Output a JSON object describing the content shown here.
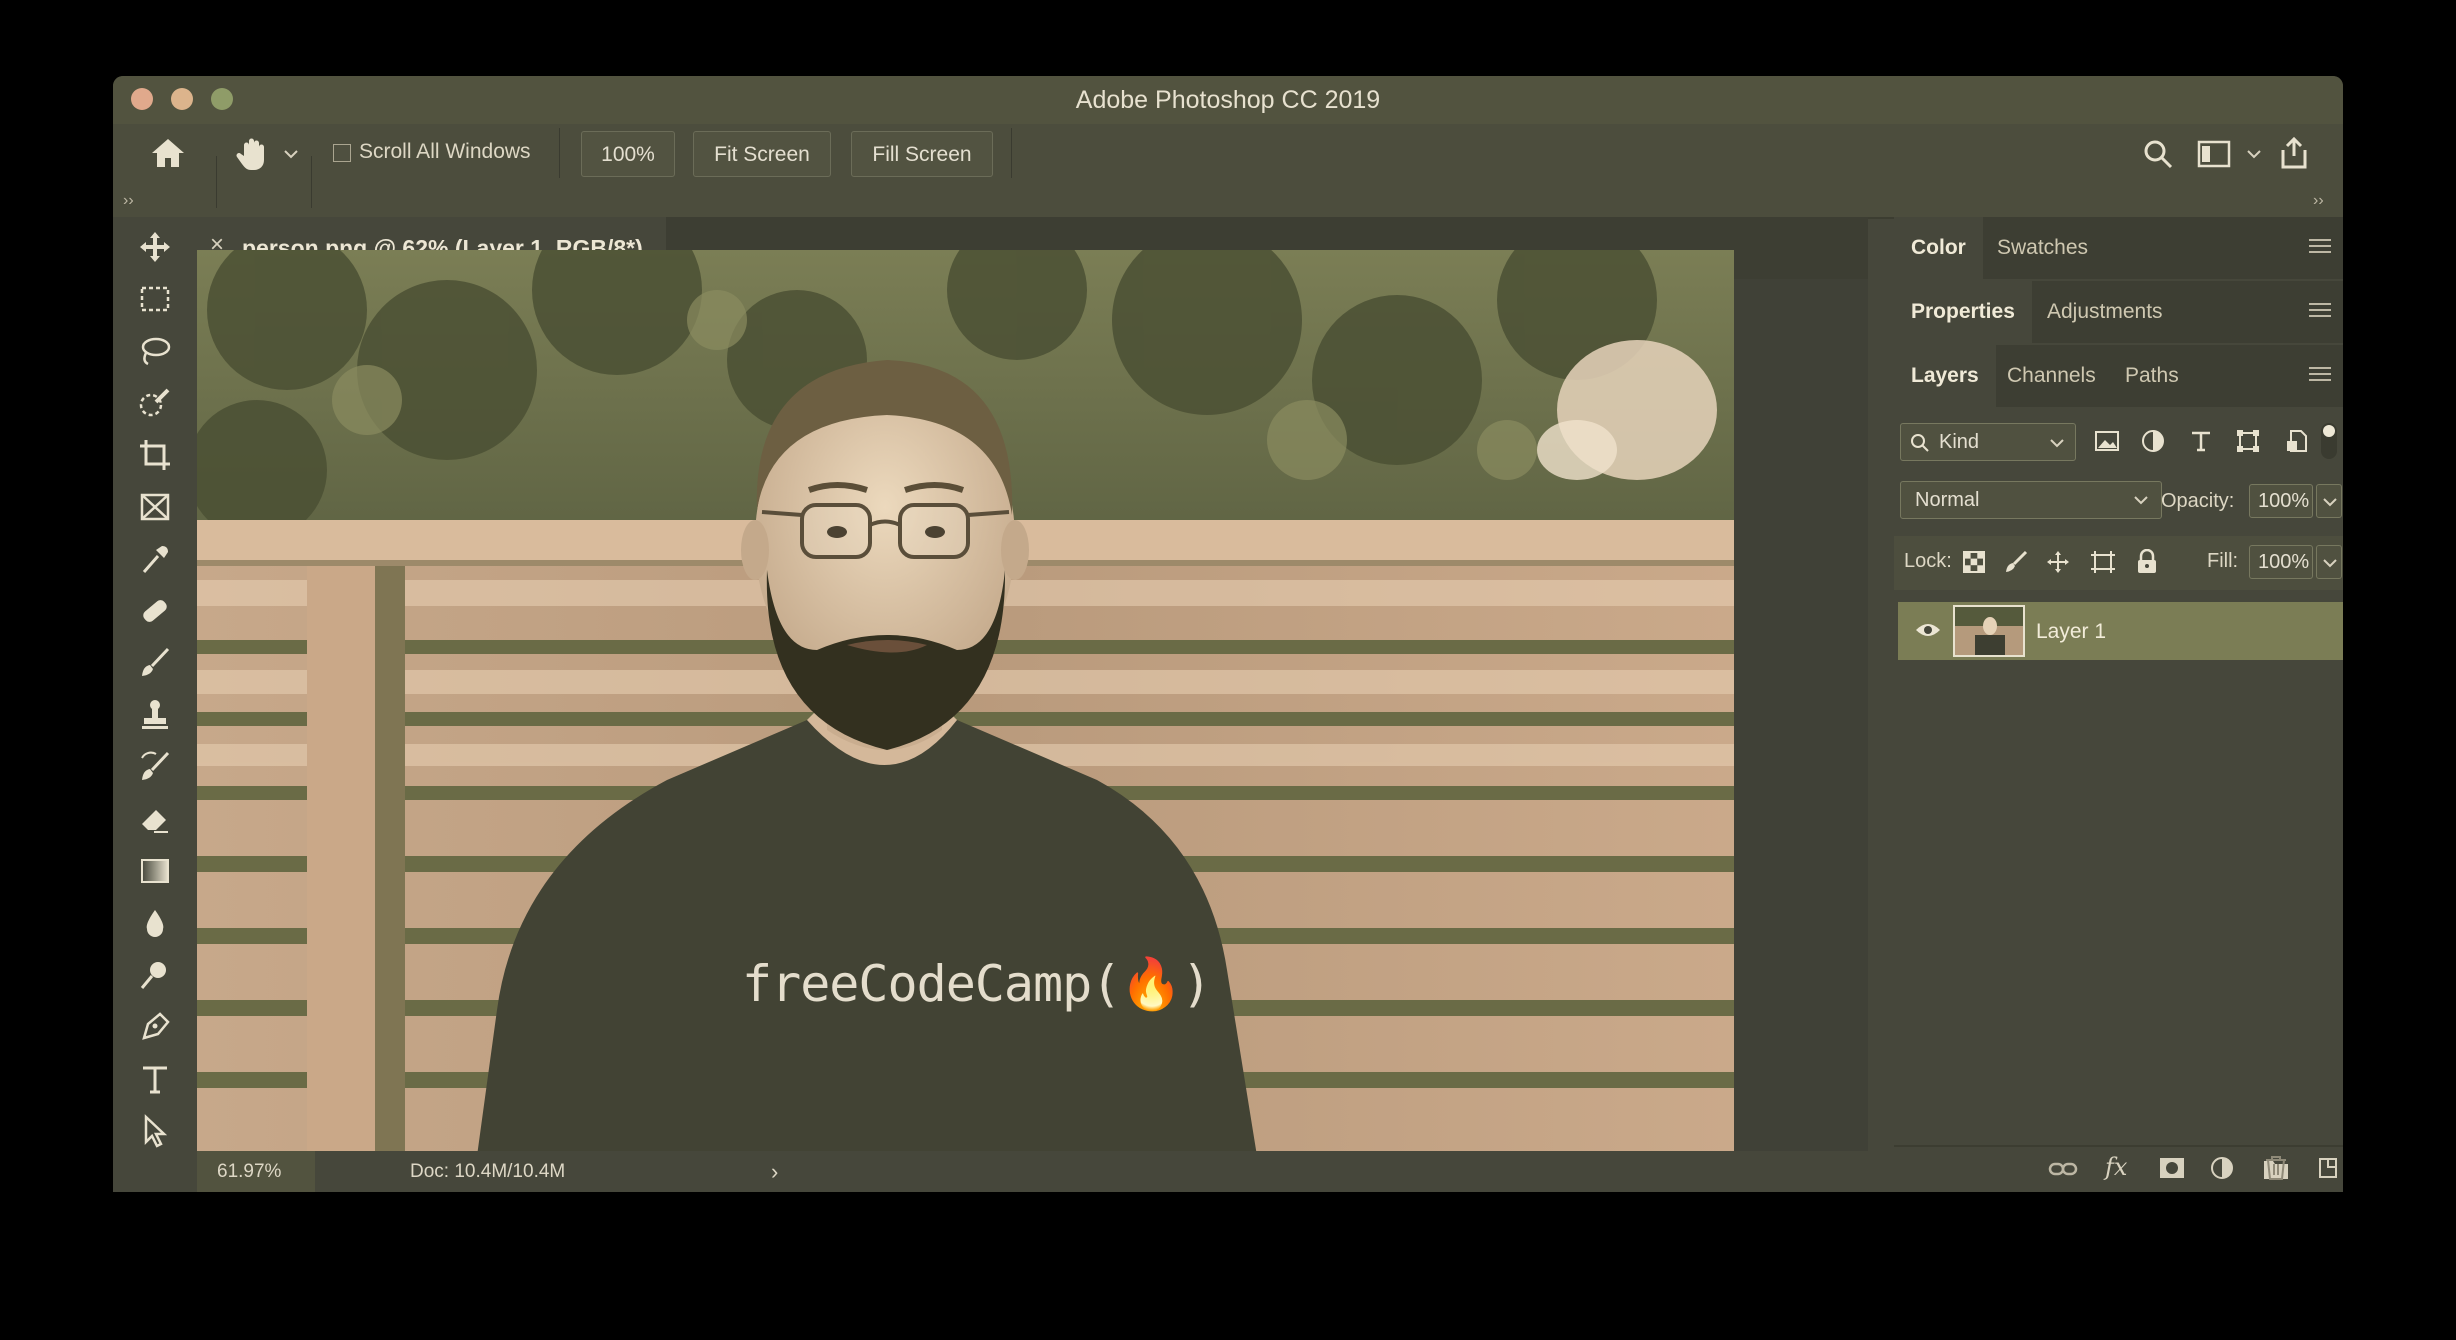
{
  "window": {
    "title": "Adobe Photoshop CC 2019",
    "traffic_lights": [
      "#e0a98c",
      "#dcb48c",
      "#8f9c68"
    ]
  },
  "options_bar": {
    "scroll_all_windows_label": "Scroll All Windows",
    "scroll_all_windows_checked": false,
    "zoom_100_label": "100%",
    "fit_screen_label": "Fit Screen",
    "fill_screen_label": "Fill Screen"
  },
  "document": {
    "tab_title": "person.png @ 62% (Layer 1, RGB/8*)",
    "close_glyph": "×",
    "shirt_text": "freeCodeCamp(🔥)"
  },
  "status_bar": {
    "zoom": "61.97%",
    "doc_size": "Doc: 10.4M/10.4M",
    "arrow": "›"
  },
  "panels": {
    "color_group": {
      "tabs": [
        "Color",
        "Swatches"
      ],
      "active": "Color"
    },
    "properties_group": {
      "tabs": [
        "Properties",
        "Adjustments"
      ],
      "active": "Properties"
    },
    "layers_group": {
      "tabs": [
        "Layers",
        "Channels",
        "Paths"
      ],
      "active": "Layers"
    },
    "filter_kind": "Kind",
    "blend_mode": "Normal",
    "opacity_label": "Opacity:",
    "opacity_value": "100%",
    "lock_label": "Lock:",
    "fill_label": "Fill:",
    "fill_value": "100%",
    "layers": [
      {
        "name": "Layer 1",
        "visible": true
      }
    ]
  },
  "colors": {
    "window_bg": "#46473b",
    "accent_layer": "#7b7d55"
  },
  "tools": [
    "move-icon",
    "marquee-icon",
    "lasso-icon",
    "quick-select-icon",
    "crop-icon",
    "frame-icon",
    "eyedropper-icon",
    "healing-brush-icon",
    "brush-icon",
    "clone-stamp-icon",
    "history-brush-icon",
    "eraser-icon",
    "gradient-icon",
    "blur-icon",
    "dodge-icon",
    "pen-icon",
    "type-icon",
    "path-select-icon"
  ]
}
